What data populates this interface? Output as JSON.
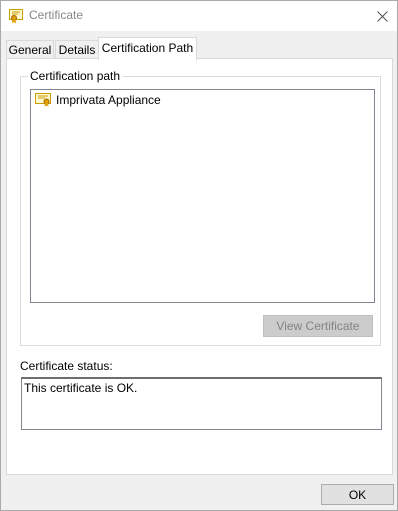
{
  "window": {
    "title": "Certificate",
    "close_icon": "close-icon",
    "title_icon": "certificate-icon"
  },
  "tabs": [
    {
      "label": "General",
      "active": false
    },
    {
      "label": "Details",
      "active": false
    },
    {
      "label": "Certification Path",
      "active": true
    }
  ],
  "certification_path": {
    "group_label": "Certification path",
    "items": [
      {
        "label": "Imprivata Appliance",
        "icon": "certificate-icon"
      }
    ],
    "view_button_label": "View Certificate",
    "view_button_enabled": false
  },
  "status": {
    "label": "Certificate status:",
    "text": "This certificate is OK."
  },
  "footer": {
    "ok_label": "OK"
  },
  "colors": {
    "disabled_button_bg": "#cccccc",
    "disabled_button_text": "#838383",
    "title_text": "#888888"
  }
}
